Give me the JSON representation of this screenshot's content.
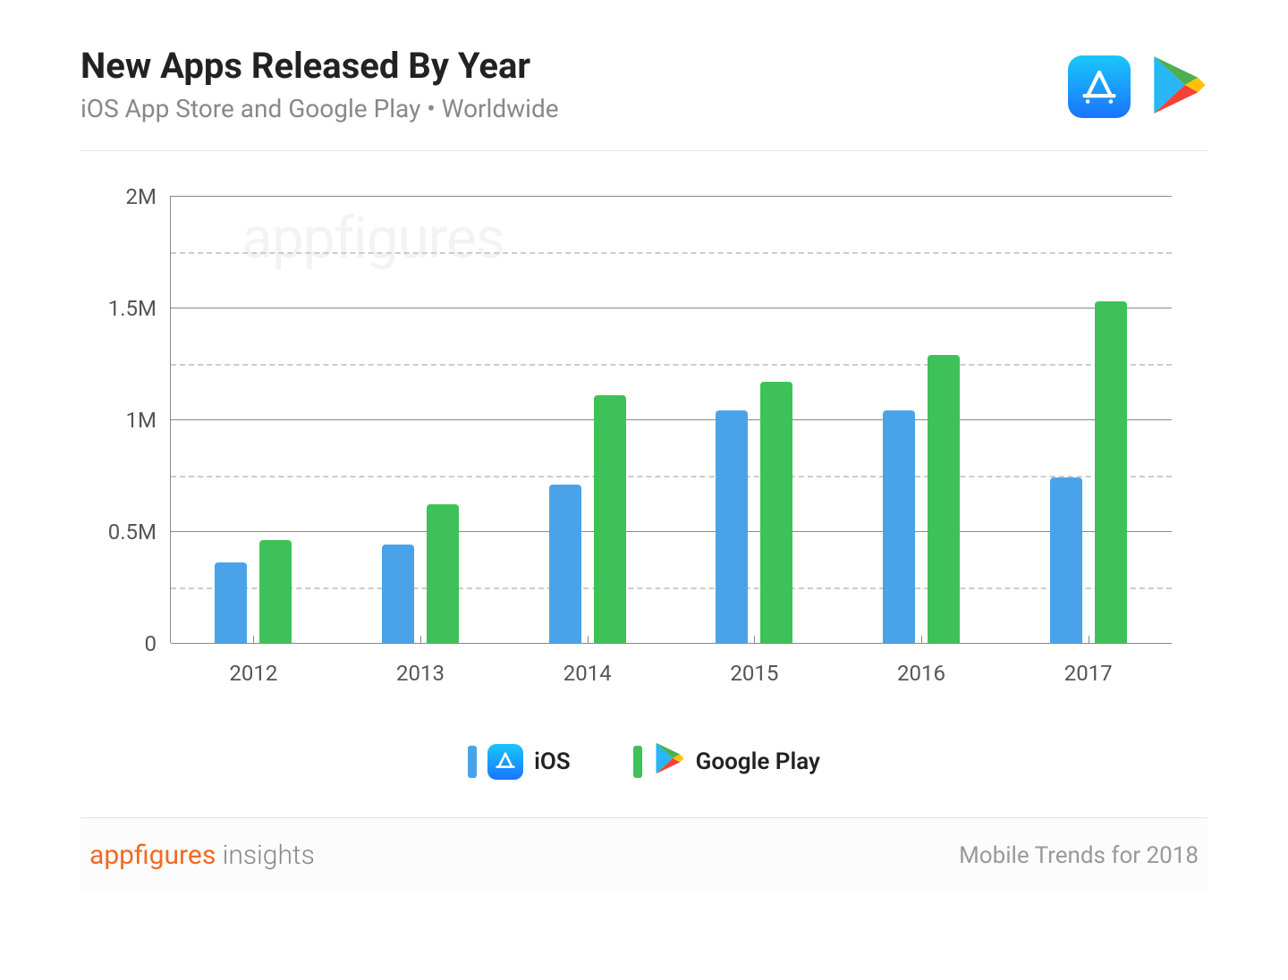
{
  "header": {
    "title": "New Apps Released By Year",
    "subtitle": "iOS App Store and Google Play • Worldwide"
  },
  "legend": {
    "ios": "iOS",
    "gplay": "Google Play"
  },
  "footer": {
    "brand_orange": "appfigures",
    "brand_rest": " insights",
    "right": "Mobile Trends for 2018"
  },
  "watermark": "appfigures",
  "y_ticks": [
    "0",
    "0.5M",
    "1M",
    "1.5M",
    "2M"
  ],
  "chart_data": {
    "type": "bar",
    "title": "New Apps Released By Year",
    "xlabel": "",
    "ylabel": "",
    "ylim": [
      0,
      2000000
    ],
    "categories": [
      "2012",
      "2013",
      "2014",
      "2015",
      "2016",
      "2017"
    ],
    "series": [
      {
        "name": "iOS",
        "values": [
          360000,
          440000,
          710000,
          1040000,
          1040000,
          740000
        ]
      },
      {
        "name": "Google Play",
        "values": [
          460000,
          620000,
          1110000,
          1170000,
          1290000,
          1530000
        ]
      }
    ]
  }
}
